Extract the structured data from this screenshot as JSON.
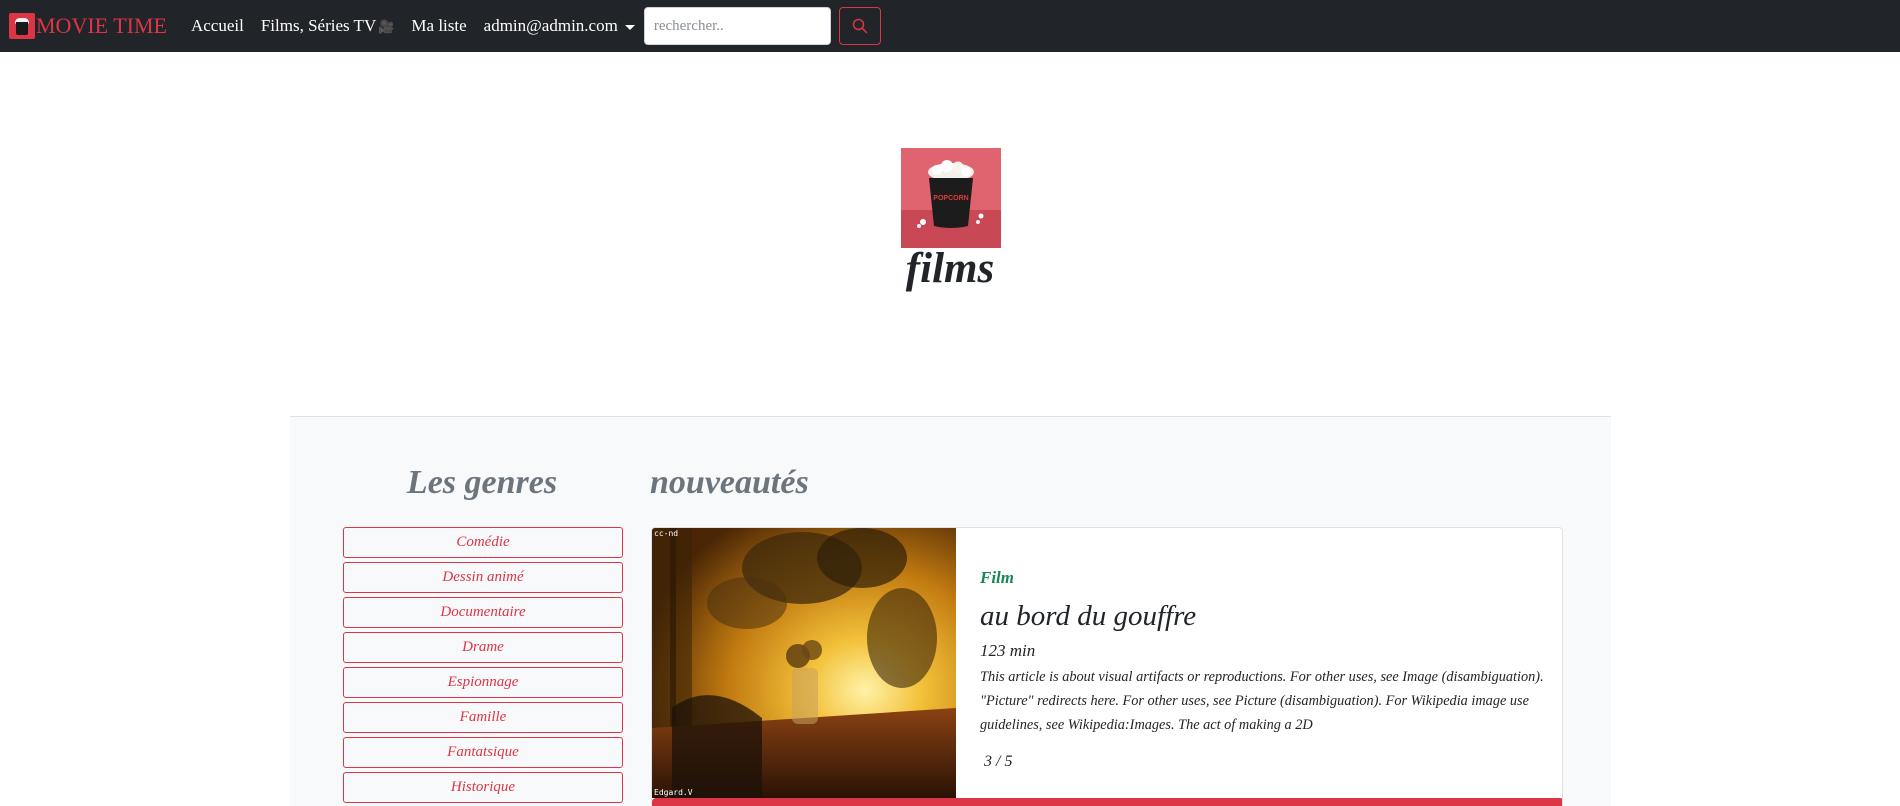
{
  "navbar": {
    "brand": "MOVIE TIME",
    "links": [
      {
        "label": "Accueil"
      },
      {
        "label": "Films, Séries TV"
      },
      {
        "label": "Ma liste"
      }
    ],
    "account": "admin@admin.com",
    "search_placeholder": "rechercher..",
    "colors": {
      "background": "#212529",
      "accent": "#dc3545"
    }
  },
  "hero": {
    "title": "films",
    "image_label": "POPCORN"
  },
  "genres": {
    "title": "Les genres",
    "items": [
      "Comédie",
      "Dessin animé",
      "Documentaire",
      "Drame",
      "Espionnage",
      "Famille",
      "Fantatsique",
      "Historique"
    ]
  },
  "news": {
    "title": "nouveautés",
    "card": {
      "type": "Film",
      "title": "au bord du gouffre",
      "duration": "123 min",
      "description": "This article is about visual artifacts or reproductions. For other uses, see Image (disambiguation). \"Picture\" redirects here. For other uses, see Picture (disambiguation). For Wikipedia image use guidelines, see Wikipedia:Images. The act of making a 2D",
      "rating": "3 / 5",
      "image_caption_top": "cc-nd",
      "image_caption_bottom": "Edgard.V"
    }
  }
}
